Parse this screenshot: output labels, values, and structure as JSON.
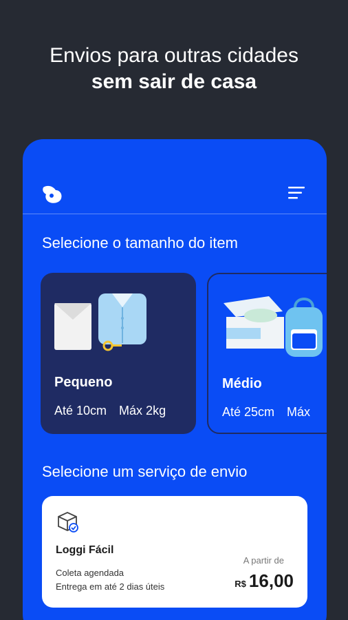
{
  "headline": {
    "line1": "Envios para outras cidades",
    "line2": "sem sair de casa"
  },
  "app": {
    "logo_icon": "loggi-bunny-icon",
    "menu_icon": "hamburger-menu-icon",
    "size_section_title": "Selecione o tamanho do item",
    "sizes": [
      {
        "name": "Pequeno",
        "dimension": "Até 10cm",
        "weight": "Máx 2kg",
        "selected": true
      },
      {
        "name": "Médio",
        "dimension": "Até 25cm",
        "weight": "Máx",
        "selected": false
      }
    ],
    "service_section_title": "Selecione um serviço de envio",
    "service": {
      "icon": "package-box-icon",
      "name": "Loggi Fácil",
      "line1": "Coleta agendada",
      "line2": "Entrega em até 2 dias úteis",
      "price_prefix": "A partir de",
      "currency": "R$",
      "price": "16,00"
    }
  },
  "colors": {
    "background": "#262a33",
    "brand_blue": "#0a4cf5",
    "card_selected": "#1f2b63"
  }
}
